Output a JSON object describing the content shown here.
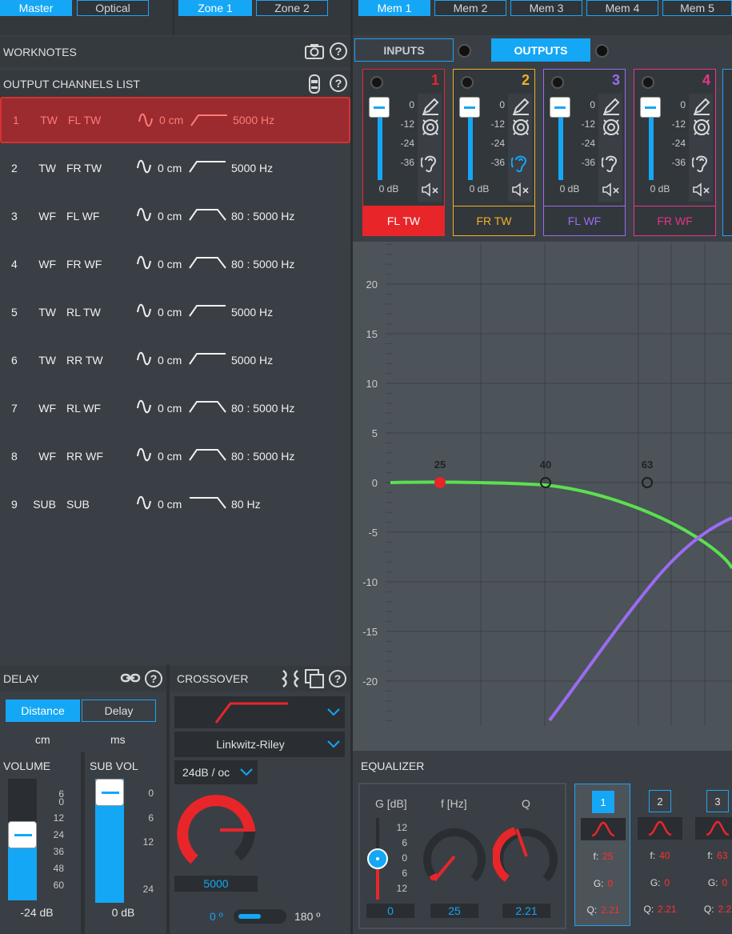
{
  "top_tabs": {
    "input_mode": [
      "Master",
      "Optical"
    ],
    "zones": [
      "Zone 1",
      "Zone 2"
    ],
    "memories": [
      "Mem 1",
      "Mem 2",
      "Mem 3",
      "Mem 4",
      "Mem 5"
    ]
  },
  "worknotes": {
    "title": "WORKNOTES"
  },
  "output_list": {
    "title": "OUTPUT CHANNELS LIST",
    "rows": [
      {
        "num": "1",
        "type": "TW",
        "name": "FL TW",
        "delay": "0 cm",
        "xover": "highpass",
        "freq": "5000  Hz",
        "selected": true
      },
      {
        "num": "2",
        "type": "TW",
        "name": "FR TW",
        "delay": "0 cm",
        "xover": "highpass",
        "freq": "5000  Hz"
      },
      {
        "num": "3",
        "type": "WF",
        "name": "FL WF",
        "delay": "0 cm",
        "xover": "bandpass",
        "freq": "80  :  5000  Hz"
      },
      {
        "num": "4",
        "type": "WF",
        "name": "FR WF",
        "delay": "0 cm",
        "xover": "bandpass",
        "freq": "80  :  5000  Hz"
      },
      {
        "num": "5",
        "type": "TW",
        "name": "RL TW",
        "delay": "0 cm",
        "xover": "highpass",
        "freq": "5000  Hz"
      },
      {
        "num": "6",
        "type": "TW",
        "name": "RR TW",
        "delay": "0 cm",
        "xover": "highpass",
        "freq": "5000  Hz"
      },
      {
        "num": "7",
        "type": "WF",
        "name": "RL WF",
        "delay": "0 cm",
        "xover": "bandpass",
        "freq": "80  :  5000  Hz"
      },
      {
        "num": "8",
        "type": "WF",
        "name": "RR WF",
        "delay": "0 cm",
        "xover": "bandpass",
        "freq": "80  :  5000  Hz"
      },
      {
        "num": "9",
        "type": "SUB",
        "name": "SUB",
        "delay": "0 cm",
        "xover": "lowpass",
        "freq": "80  Hz"
      }
    ]
  },
  "io_tabs": {
    "inputs": "INPUTS",
    "outputs": "OUTPUTS"
  },
  "channels": [
    {
      "num": "1",
      "label": "FL TW",
      "color": "#e8262a",
      "db": "0 dB",
      "level": 1.0,
      "active": true
    },
    {
      "num": "2",
      "label": "FR TW",
      "color": "#f2b027",
      "db": "0 dB",
      "level": 1.0
    },
    {
      "num": "3",
      "label": "FL WF",
      "color": "#9a6cf0",
      "db": "0 dB",
      "level": 1.0
    },
    {
      "num": "4",
      "label": "FR WF",
      "color": "#e8348a",
      "db": "0 dB",
      "level": 1.0
    }
  ],
  "channel_scale": [
    "0",
    "-12",
    "-24",
    "-36"
  ],
  "graph": {
    "y_ticks": [
      "20",
      "15",
      "10",
      "5",
      "0",
      "-5",
      "-10",
      "-15",
      "-20"
    ],
    "markers": [
      "25",
      "40",
      "63"
    ]
  },
  "delay": {
    "title": "DELAY",
    "distance_btn": "Distance",
    "delay_btn": "Delay",
    "unit_cm": "cm",
    "unit_ms": "ms"
  },
  "volume": {
    "title": "VOLUME",
    "scale": [
      "6",
      "0",
      "12",
      "24",
      "36",
      "48",
      "60"
    ],
    "value": "-24 dB"
  },
  "sub_vol": {
    "title": "SUB VOL",
    "scale": [
      "0",
      "6",
      "12",
      "24"
    ],
    "value": "0 dB"
  },
  "crossover": {
    "title": "CROSSOVER",
    "type": "Linkwitz-Riley",
    "slope": "24dB / oc",
    "freq": "5000",
    "phase_0": "0 º",
    "phase_180": "180 º"
  },
  "equalizer": {
    "title": "EQUALIZER",
    "g_label": "G [dB]",
    "f_label": "f [Hz]",
    "q_label": "Q",
    "g_scale": [
      "12",
      "6",
      "0",
      "6",
      "12"
    ],
    "g_value": "0",
    "f_value": "25",
    "q_value": "2.21",
    "bands": [
      {
        "num": "1",
        "f": "25",
        "g": "0",
        "q": "2.21",
        "selected": true
      },
      {
        "num": "2",
        "f": "40",
        "g": "0",
        "q": "2.21"
      },
      {
        "num": "3",
        "f": "63",
        "g": "0",
        "q": "2.2"
      }
    ],
    "band_labels": {
      "f": "f:",
      "g": "G:",
      "q": "Q:"
    }
  }
}
